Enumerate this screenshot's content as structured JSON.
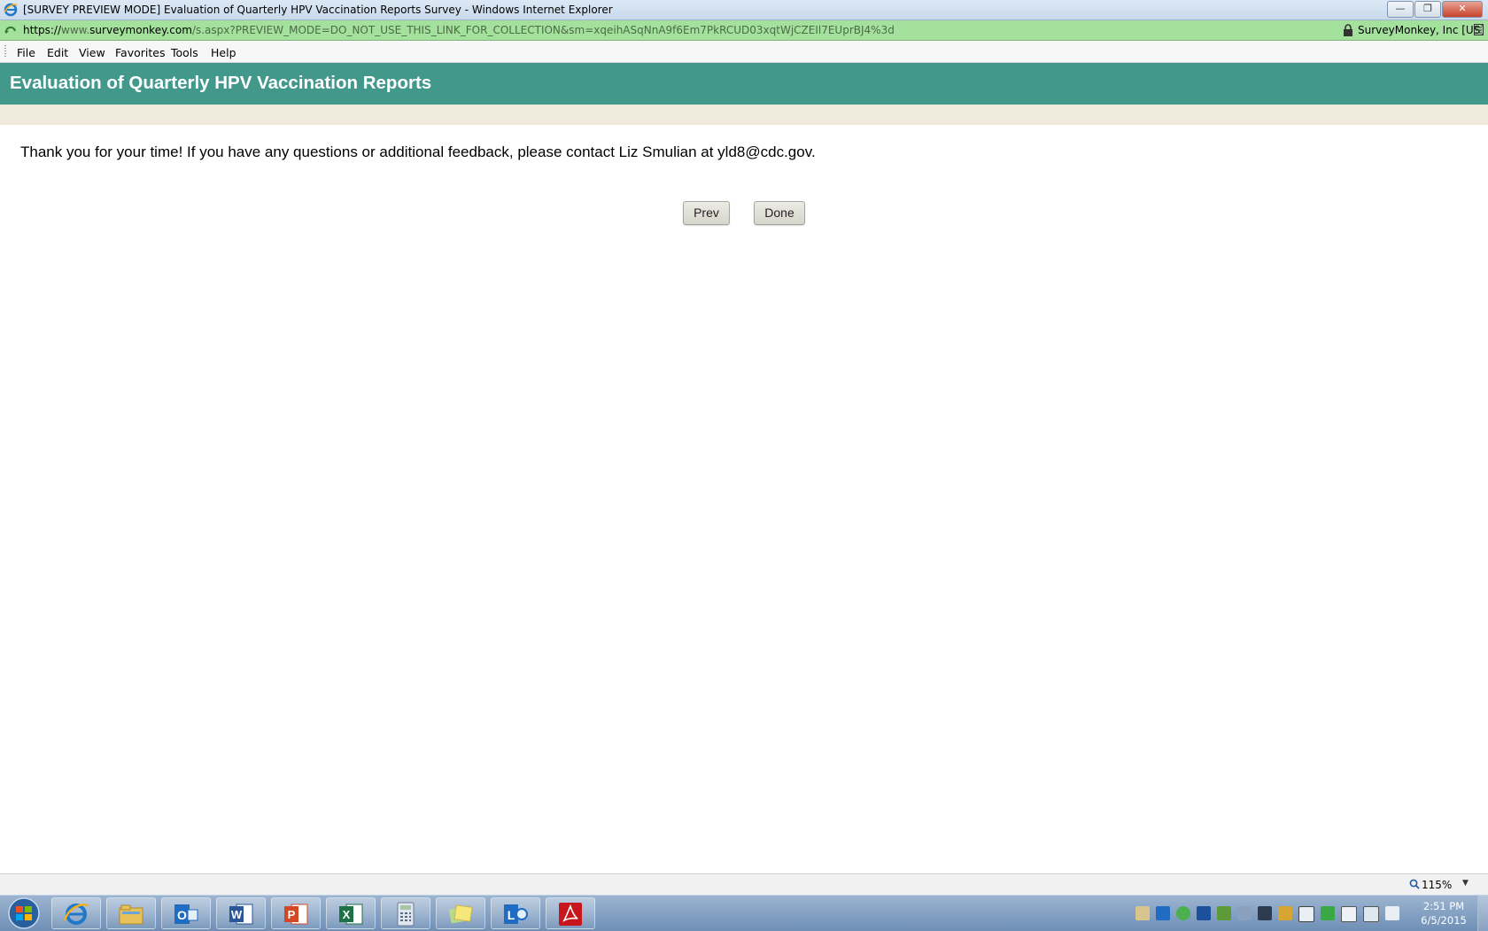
{
  "window": {
    "title": "[SURVEY PREVIEW MODE] Evaluation of Quarterly HPV Vaccination Reports Survey - Windows Internet Explorer",
    "minimize_icon": "minimize-icon",
    "restore_icon": "restore-icon",
    "close_icon": "close-icon"
  },
  "address": {
    "proto": "https://",
    "sub": "www.",
    "host": "surveymonkey.com",
    "rest": "/s.aspx?PREVIEW_MODE=DO_NOT_USE_THIS_LINK_FOR_COLLECTION&sm=xqeihASqNnA9f6Em7PkRCUD03xqtWjCZEIl7EUprBJ4%3d",
    "certificate": "SurveyMonkey, Inc [US]",
    "bar_color": "#a4e19c"
  },
  "menu": {
    "items": [
      "File",
      "Edit",
      "View",
      "Favorites",
      "Tools",
      "Help"
    ]
  },
  "survey": {
    "title": "Evaluation of Quarterly HPV Vaccination Reports",
    "header_color": "#43988c",
    "message": "Thank you for your time! If you have any questions or additional feedback, please contact Liz Smulian at yld8@cdc.gov.",
    "prev_label": "Prev",
    "done_label": "Done"
  },
  "status": {
    "zoom": "115%"
  },
  "taskbar": {
    "apps": [
      "internet-explorer",
      "file-explorer",
      "outlook",
      "word",
      "powerpoint",
      "excel",
      "calculator",
      "sticky-notes",
      "lync",
      "adobe-acrobat"
    ],
    "time": "2:51 PM",
    "date": "6/5/2015"
  }
}
